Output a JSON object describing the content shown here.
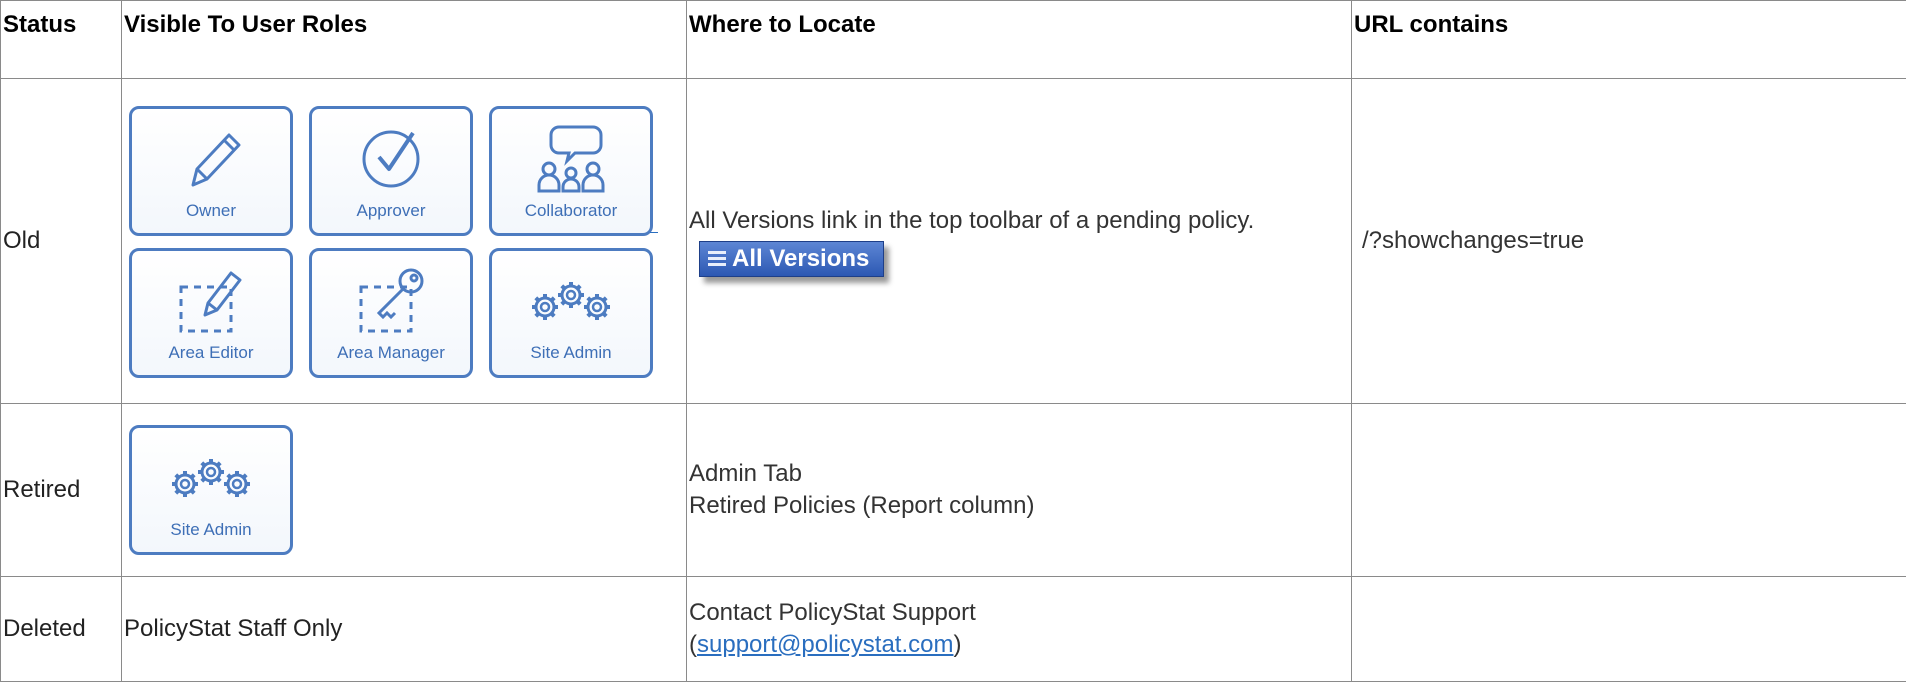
{
  "headers": {
    "status": "Status",
    "roles": "Visible To User Roles",
    "where": "Where to Locate",
    "url": "URL contains"
  },
  "rows": {
    "old": {
      "status": "Old",
      "badges": [
        {
          "label": "Owner",
          "icon": "pencil-icon"
        },
        {
          "label": "Approver",
          "icon": "check-circle-icon"
        },
        {
          "label": "Collaborator",
          "icon": "people-chat-icon"
        },
        {
          "label": "Area Editor",
          "icon": "area-pencil-icon"
        },
        {
          "label": "Area Manager",
          "icon": "area-key-icon"
        },
        {
          "label": "Site Admin",
          "icon": "gears-icon"
        }
      ],
      "where_text": "All Versions link in the top toolbar of a pending policy.",
      "button_label": "All Versions",
      "url": "/?showchanges=true"
    },
    "retired": {
      "status": "Retired",
      "badge": {
        "label": "Site Admin",
        "icon": "gears-icon"
      },
      "where_line1": "Admin Tab",
      "where_line2": "Retired Policies (Report column)",
      "url": ""
    },
    "deleted": {
      "status": "Deleted",
      "roles": "PolicyStat Staff Only",
      "where_line1": "Contact PolicyStat Support",
      "open_paren": "(",
      "email": "support@policystat.com",
      "close_paren": ")",
      "url": ""
    }
  },
  "colors": {
    "badge_border": "#4d7cc1",
    "link": "#2a6ebf",
    "button": "#3a66c2"
  }
}
